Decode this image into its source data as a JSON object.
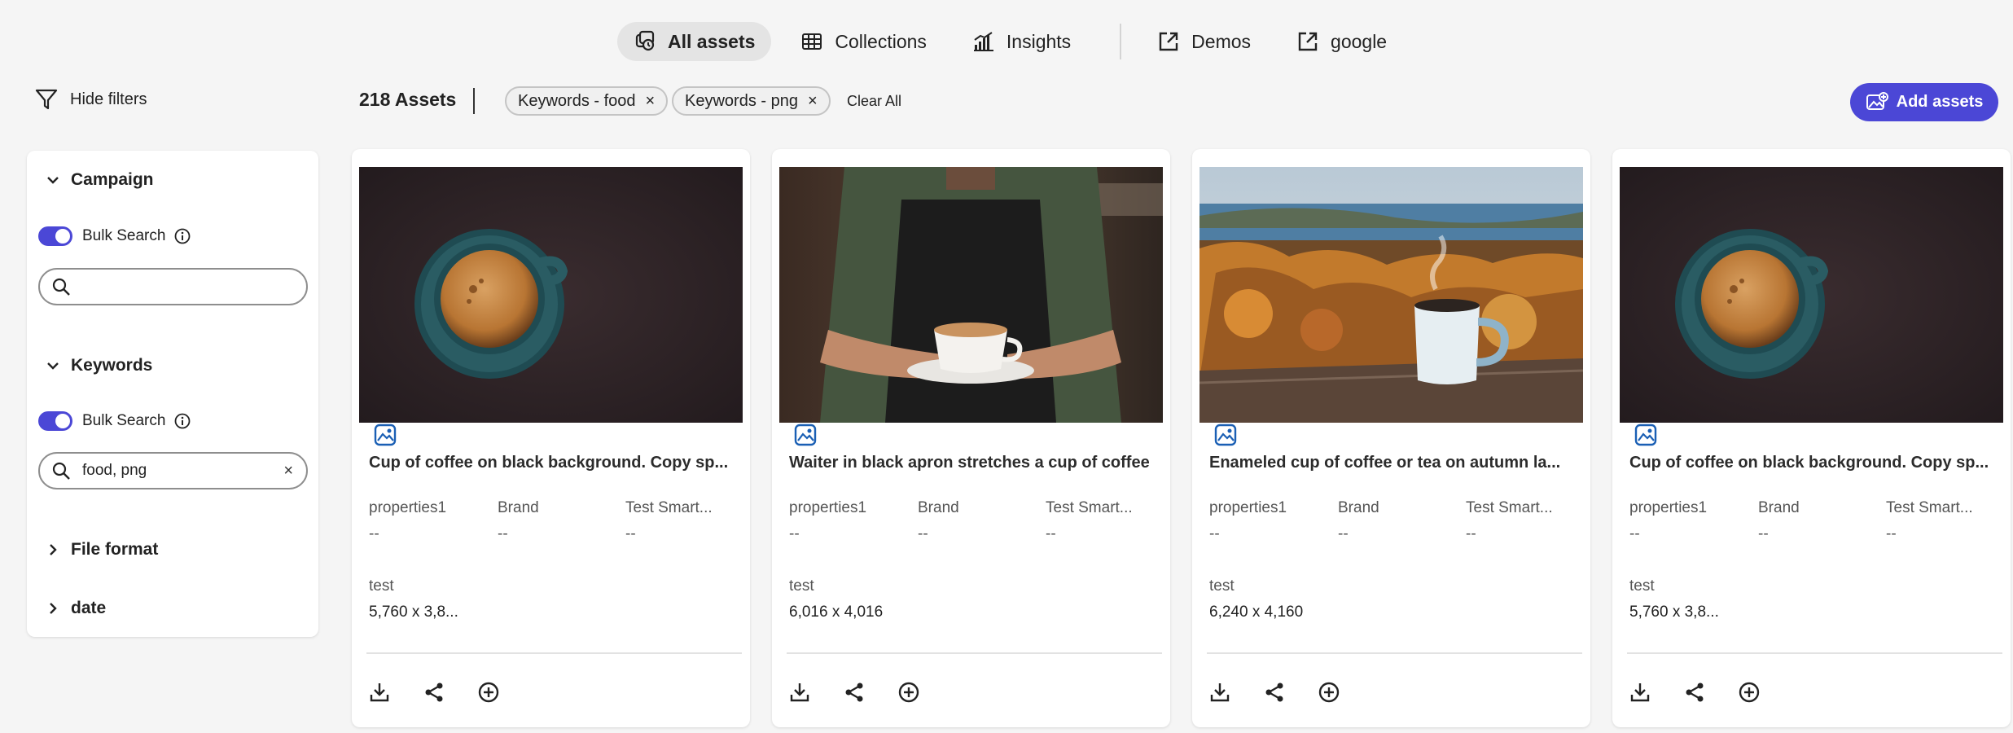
{
  "nav": {
    "tabs": [
      {
        "label": "All assets",
        "icon": "all-assets-icon",
        "active": true
      },
      {
        "label": "Collections",
        "icon": "collections-grid-icon"
      },
      {
        "label": "Insights",
        "icon": "insights-chart-icon"
      }
    ],
    "links": [
      {
        "label": "Demos",
        "icon": "external-link-icon"
      },
      {
        "label": "google",
        "icon": "external-link-icon"
      }
    ]
  },
  "toolbar": {
    "hide_filters": "Hide filters",
    "asset_count": "218 Assets",
    "chips": [
      "Keywords - food",
      "Keywords - png"
    ],
    "chip_close": "×",
    "clear_all": "Clear All",
    "add_assets": "Add assets"
  },
  "filters": {
    "campaign": {
      "title": "Campaign",
      "bulk_label": "Bulk Search",
      "search_value": ""
    },
    "keywords": {
      "title": "Keywords",
      "bulk_label": "Bulk Search",
      "search_value": "food, png",
      "clear": "×"
    },
    "file_format": {
      "title": "File format"
    },
    "date": {
      "title": "date"
    }
  },
  "cards": [
    {
      "title": "Cup of coffee on black background. Copy sp...",
      "image": "coffee-cup-black-bg",
      "props": [
        {
          "label": "properties1",
          "value": "--"
        },
        {
          "label": "Brand",
          "value": "--"
        },
        {
          "label": "Test Smart...",
          "value": "--"
        }
      ],
      "test_label": "test",
      "dimensions": "5,760 x 3,8..."
    },
    {
      "title": "Waiter in black apron stretches a cup of coffee",
      "image": "waiter-with-coffee",
      "props": [
        {
          "label": "properties1",
          "value": "--"
        },
        {
          "label": "Brand",
          "value": "--"
        },
        {
          "label": "Test Smart...",
          "value": "--"
        }
      ],
      "test_label": "test",
      "dimensions": "6,016 x 4,016"
    },
    {
      "title": "Enameled cup of coffee or tea on autumn la...",
      "image": "enamel-mug-autumn",
      "props": [
        {
          "label": "properties1",
          "value": "--"
        },
        {
          "label": "Brand",
          "value": "--"
        },
        {
          "label": "Test Smart...",
          "value": "--"
        }
      ],
      "test_label": "test",
      "dimensions": "6,240 x 4,160"
    },
    {
      "title": "Cup of coffee on black background. Copy sp...",
      "image": "coffee-cup-black-bg",
      "props": [
        {
          "label": "properties1",
          "value": "--"
        },
        {
          "label": "Brand",
          "value": "--"
        },
        {
          "label": "Test Smart...",
          "value": "--"
        }
      ],
      "test_label": "test",
      "dimensions": "5,760 x 3,8..."
    }
  ],
  "colors": {
    "accent": "#4b47d6",
    "background": "#f5f5f5",
    "card": "#ffffff"
  }
}
